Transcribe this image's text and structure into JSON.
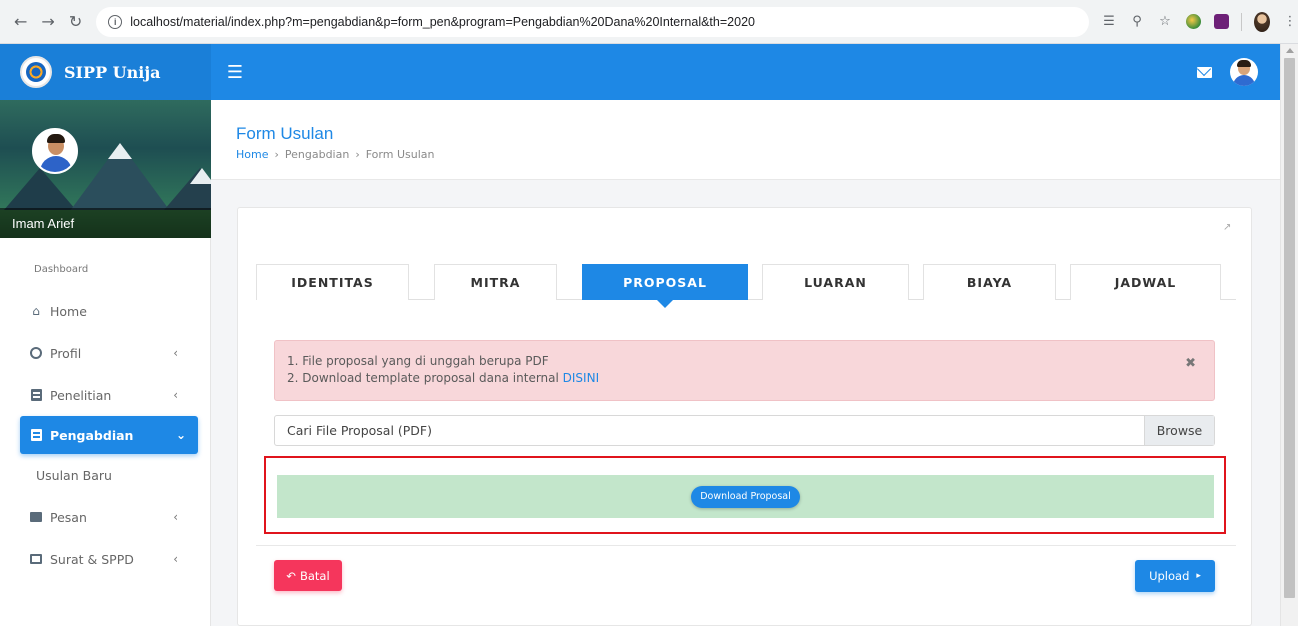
{
  "browser": {
    "url": "localhost/material/index.php?m=pengabdian&p=form_pen&program=Pengabdian%20Dana%20Internal&th=2020"
  },
  "app": {
    "brand": "SIPP Unija"
  },
  "sidebar": {
    "username": "Imam Arief",
    "section_label": "Dashboard",
    "items": [
      {
        "label": "Home",
        "icon": "home-icon"
      },
      {
        "label": "Profil",
        "icon": "user-circle-icon"
      },
      {
        "label": "Penelitian",
        "icon": "document-icon"
      },
      {
        "label": "Pengabdian",
        "icon": "document-icon",
        "active": true
      },
      {
        "label": "Usulan Baru"
      },
      {
        "label": "Pesan",
        "icon": "envelope-icon"
      },
      {
        "label": "Surat & SPPD",
        "icon": "envelope-open-icon"
      }
    ]
  },
  "header": {
    "title": "Form Usulan",
    "breadcrumb": [
      "Home",
      "Pengabdian",
      "Form Usulan"
    ]
  },
  "tabs": [
    "IDENTITAS",
    "MITRA",
    "PROPOSAL",
    "LUARAN",
    "BIAYA",
    "JADWAL"
  ],
  "active_tab": "PROPOSAL",
  "alert": {
    "line1": "1. File proposal yang di unggah berupa PDF",
    "line2_prefix": "2. Download template proposal dana internal ",
    "line2_link": "DISINI"
  },
  "file_input": {
    "label": "Cari File Proposal (PDF)",
    "browse": "Browse"
  },
  "download_button": "Download Proposal",
  "actions": {
    "batal": "Batal",
    "upload": "Upload"
  },
  "colors": {
    "primary": "#1e88e5",
    "danger": "#f5365c",
    "alert_bg": "#f8d7da",
    "success_bg": "#c3e6cb",
    "highlight": "#e0141c"
  }
}
